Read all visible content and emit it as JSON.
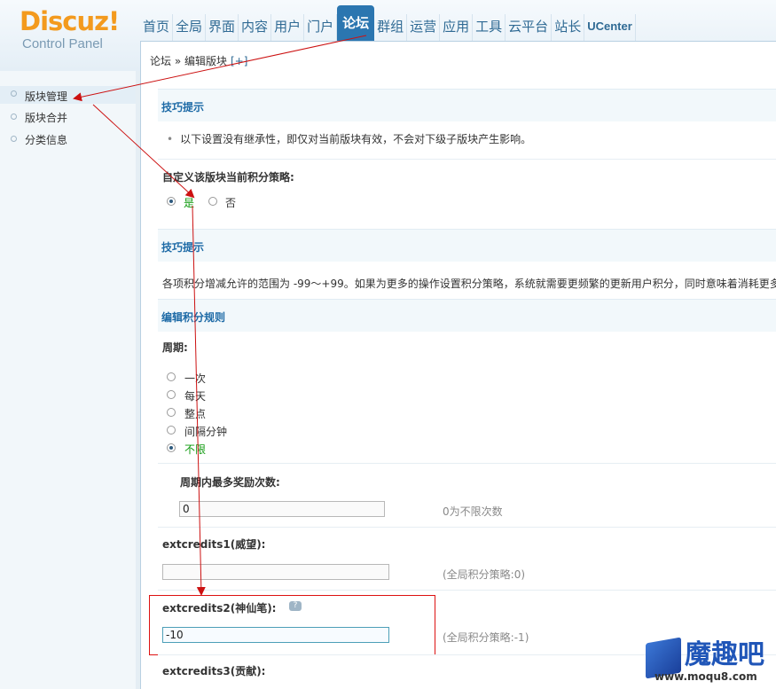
{
  "logo": {
    "main": "Discuz",
    "bang": "!",
    "sub": "Control Panel"
  },
  "nav": [
    {
      "label": "首页",
      "active": false
    },
    {
      "label": "全局",
      "active": false
    },
    {
      "label": "界面",
      "active": false
    },
    {
      "label": "内容",
      "active": false
    },
    {
      "label": "用户",
      "active": false
    },
    {
      "label": "门户",
      "active": false
    },
    {
      "label": "论坛",
      "active": true
    },
    {
      "label": "群组",
      "active": false
    },
    {
      "label": "运营",
      "active": false
    },
    {
      "label": "应用",
      "active": false
    },
    {
      "label": "工具",
      "active": false
    },
    {
      "label": "云平台",
      "active": false
    },
    {
      "label": "站长",
      "active": false
    },
    {
      "label": "UCenter",
      "active": false
    }
  ],
  "breadcrumb": {
    "text": "论坛 » 编辑版块",
    "add": "[+]"
  },
  "sidebar": {
    "items": [
      {
        "label": "版块管理"
      },
      {
        "label": "版块合并"
      },
      {
        "label": "分类信息"
      }
    ]
  },
  "section1": {
    "title": "技巧提示",
    "tip": "以下设置没有继承性，即仅对当前版块有效，不会对下级子版块产生影响。",
    "bullet": "•"
  },
  "custom_policy": {
    "label": "自定义该版块当前积分策略:",
    "yes": "是",
    "no": "否",
    "selected": "yes"
  },
  "section2": {
    "title": "技巧提示",
    "tip": "各项积分增减允许的范围为 -99～+99。如果为更多的操作设置积分策略，系统就需要更频繁的更新用户积分，同时意味着消耗更多"
  },
  "section3": {
    "title": "编辑积分规则"
  },
  "period": {
    "label": "周期:",
    "options": [
      "一次",
      "每天",
      "整点",
      "间隔分钟",
      "不限"
    ],
    "selected": "不限"
  },
  "max_rewards": {
    "label": "周期内最多奖励次数:",
    "value": "0",
    "hint": "0为不限次数"
  },
  "extcredits1": {
    "label": "extcredits1(威望):",
    "value": "",
    "hint": "(全局积分策略:0)"
  },
  "extcredits2": {
    "label": "extcredits2(神仙笔):",
    "value": "-10",
    "hint": "(全局积分策略:-1)",
    "help_icon": "question-bubble-icon"
  },
  "extcredits3": {
    "label": "extcredits3(贡献):"
  },
  "watermark": {
    "text": "魔趣吧",
    "site": "www.moqu8.com"
  },
  "colors": {
    "accent": "#2b76b0",
    "brand_orange": "#f39a1e",
    "annotation": "#cc1111",
    "selected_green": "#0e9a0e"
  }
}
